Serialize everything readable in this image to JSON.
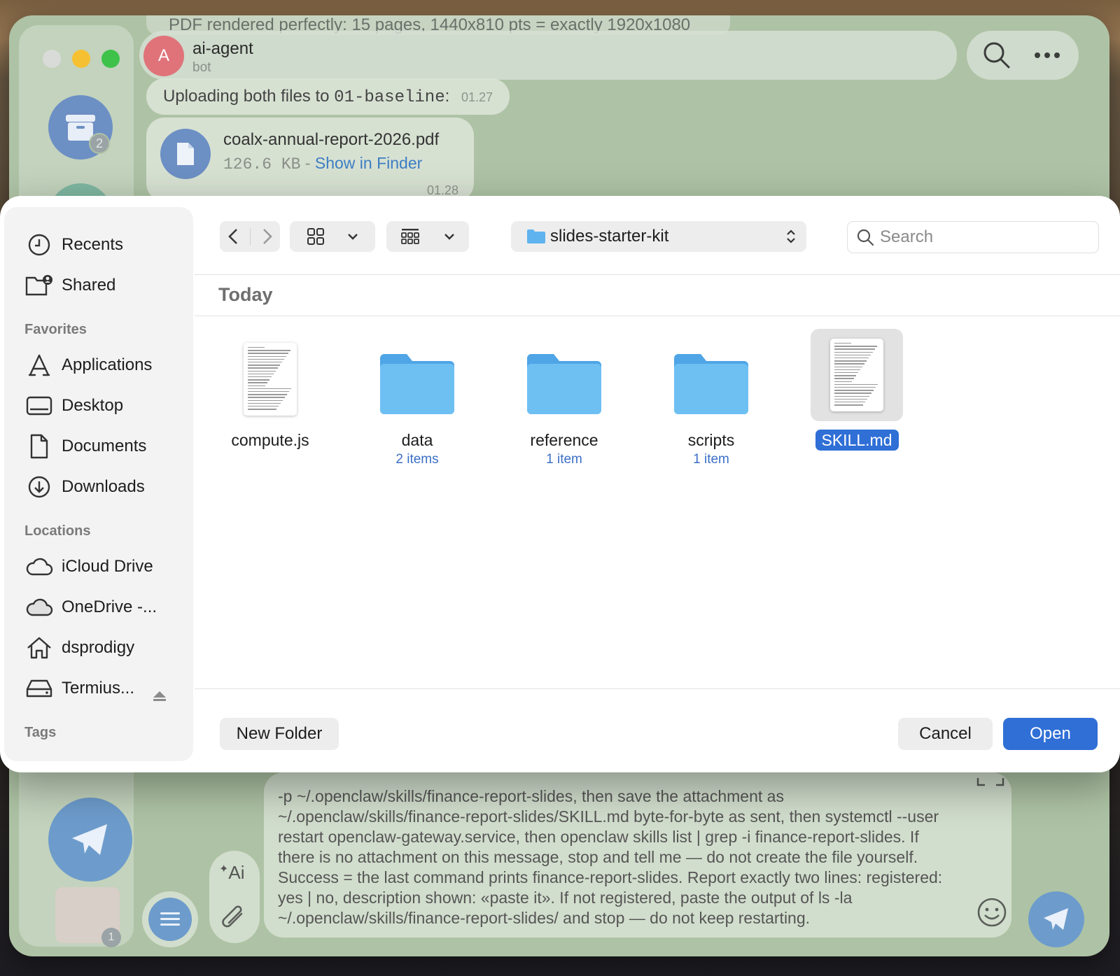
{
  "telegram": {
    "sidebar": {
      "archive_badge": "2",
      "sticker_badge": "1"
    },
    "faded_message": "PDF rendered perfectly: 15 pages, 1440x810 pts = exactly 1920x1080",
    "chat": {
      "avatar_letter": "A",
      "name": "ai-agent",
      "subtitle": "bot"
    },
    "messages": {
      "upload_prefix": "Uploading both files to ",
      "upload_target": "01-baseline",
      "upload_suffix": ":",
      "upload_time": "01.27",
      "file_name": "coalx-annual-report-2026.pdf",
      "file_size": "126.6 KB",
      "file_sep": " - ",
      "file_link": "Show in Finder",
      "file_time": "01.28"
    },
    "composer_text": "-p ~/.openclaw/skills/finance-report-slides, then save the attachment as ~/.openclaw/skills/finance-report-slides/SKILL.md byte-for-byte as sent, then systemctl --user restart openclaw-gateway.service, then openclaw skills list | grep -i finance-report-slides. If there is no attachment on this message, stop and tell me — do not create the file yourself. Success = the last command prints finance-report-slides. Report exactly two lines: registered: yes | no, description shown: «paste it». If not registered, paste the output of ls -la ~/.openclaw/skills/finance-report-slides/ and stop — do not keep restarting.",
    "ai_label": "Ai"
  },
  "dialog": {
    "sidebar": {
      "top_items": [
        {
          "label": "Recents",
          "icon": "clock-icon"
        },
        {
          "label": "Shared",
          "icon": "shared-folder-icon"
        }
      ],
      "favorites_heading": "Favorites",
      "favorites": [
        {
          "label": "Applications",
          "icon": "applications-icon"
        },
        {
          "label": "Desktop",
          "icon": "desktop-icon"
        },
        {
          "label": "Documents",
          "icon": "document-icon"
        },
        {
          "label": "Downloads",
          "icon": "download-icon"
        }
      ],
      "locations_heading": "Locations",
      "locations": [
        {
          "label": "iCloud Drive",
          "icon": "cloud-icon"
        },
        {
          "label": "OneDrive -...",
          "icon": "cloud-filled-icon"
        },
        {
          "label": "dsprodigy",
          "icon": "home-icon"
        },
        {
          "label": "Termius...",
          "icon": "drive-icon"
        }
      ],
      "tags_heading": "Tags"
    },
    "toolbar": {
      "current_folder": "slides-starter-kit",
      "search_placeholder": "Search"
    },
    "section_title": "Today",
    "files": [
      {
        "name": "compute.js",
        "kind": "document",
        "count": ""
      },
      {
        "name": "data",
        "kind": "folder",
        "count": "2 items"
      },
      {
        "name": "reference",
        "kind": "folder",
        "count": "1 item"
      },
      {
        "name": "scripts",
        "kind": "folder",
        "count": "1 item"
      },
      {
        "name": "SKILL.md",
        "kind": "document",
        "count": "",
        "selected": true
      }
    ],
    "buttons": {
      "new_folder": "New Folder",
      "cancel": "Cancel",
      "open": "Open"
    }
  }
}
